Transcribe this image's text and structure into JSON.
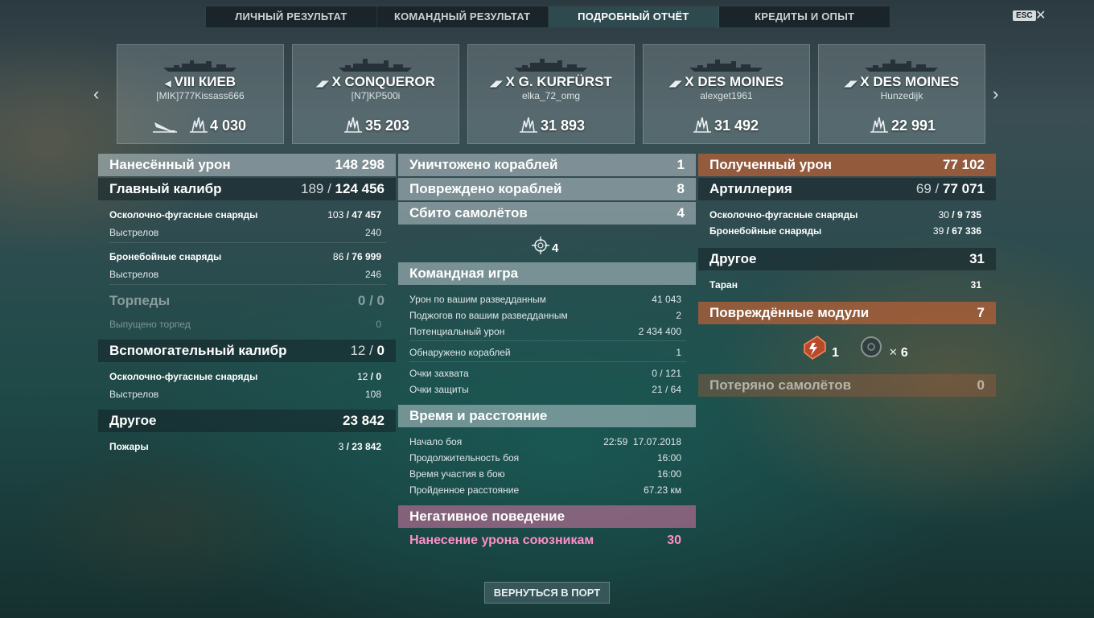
{
  "tabs": [
    "ЛИЧНЫЙ РЕЗУЛЬТАТ",
    "КОМАНДНЫЙ РЕЗУЛЬТАТ",
    "ПОДРОБНЫЙ ОТЧЁТ",
    "КРЕДИТЫ И ОПЫТ"
  ],
  "active_tab": "ПОДРОБНЫЙ ОТЧЁТ",
  "esc_label": "ESC",
  "close_glyph": "✕",
  "ships": [
    {
      "tier": "VIII",
      "name": "КИЕВ",
      "player": "[MIK]777Kissass666",
      "damage": "4 030",
      "sunk": true
    },
    {
      "tier": "X",
      "name": "CONQUEROR",
      "player": "[N7]KP500i",
      "damage": "35 203",
      "sunk": false
    },
    {
      "tier": "X",
      "name": "G. KURFÜRST",
      "player": "elka_72_omg",
      "damage": "31 893",
      "sunk": false
    },
    {
      "tier": "X",
      "name": "DES MOINES",
      "player": "alexget1961",
      "damage": "31 492",
      "sunk": false
    },
    {
      "tier": "X",
      "name": "DES MOINES",
      "player": "Hunzedijk",
      "damage": "22 991",
      "sunk": false
    }
  ],
  "left": {
    "dealt": {
      "label": "Нанесённый урон",
      "value": "148 298"
    },
    "main": {
      "label": "Главный калибр",
      "hits": "189",
      "value": "124 456"
    },
    "he": {
      "label": "Осколочно-фугасные снаряды",
      "hits": "103",
      "value": "47 457"
    },
    "he_shots": {
      "label": "Выстрелов",
      "value": "240"
    },
    "ap": {
      "label": "Бронебойные снаряды",
      "hits": "86",
      "value": "76 999"
    },
    "ap_shots": {
      "label": "Выстрелов",
      "value": "246"
    },
    "torp": {
      "label": "Торпеды",
      "hits": "0",
      "value": "0"
    },
    "torp_fired": {
      "label": "Выпущено торпед",
      "value": "0"
    },
    "secondary": {
      "label": "Вспомогательный калибр",
      "hits": "12",
      "value": "0"
    },
    "sec_he": {
      "label": "Осколочно-фугасные снаряды",
      "hits": "12",
      "value": "0"
    },
    "sec_shots": {
      "label": "Выстрелов",
      "value": "108"
    },
    "other": {
      "label": "Другое",
      "value": "23 842"
    },
    "fires": {
      "label": "Пожары",
      "hits": "3",
      "value": "23 842"
    }
  },
  "mid": {
    "destroyed": {
      "label": "Уничтожено кораблей",
      "value": "1"
    },
    "damaged": {
      "label": "Повреждено кораблей",
      "value": "8"
    },
    "planes": {
      "label": "Сбито самолётов",
      "value": "4"
    },
    "spotting_count": "4",
    "team": {
      "label": "Командная игра"
    },
    "spot_dmg": {
      "label": "Урон по вашим разведданным",
      "value": "41 043"
    },
    "spot_fires": {
      "label": "Поджогов по вашим разведданным",
      "value": "2"
    },
    "potential": {
      "label": "Потенциальный урон",
      "value": "2 434 400"
    },
    "detected": {
      "label": "Обнаружено кораблей",
      "value": "1"
    },
    "cap": {
      "label": "Очки захвата",
      "value": "0 / 121"
    },
    "defense": {
      "label": "Очки защиты",
      "value": "21 / 64"
    },
    "time": {
      "label": "Время и расстояние"
    },
    "start": {
      "label": "Начало боя",
      "value": "22:59  17.07.2018"
    },
    "duration": {
      "label": "Продолжительность боя",
      "value": "16:00"
    },
    "participation": {
      "label": "Время участия в бою",
      "value": "16:00"
    },
    "distance": {
      "label": "Пройденное расстояние",
      "value": "67.23 км"
    },
    "negative": {
      "label": "Негативное поведение"
    },
    "ally_dmg": {
      "label": "Нанесение урона союзникам",
      "value": "30"
    }
  },
  "right": {
    "received": {
      "label": "Полученный урон",
      "value": "77 102"
    },
    "artillery": {
      "label": "Артиллерия",
      "hits": "69",
      "value": "77 071"
    },
    "he": {
      "label": "Осколочно-фугасные снаряды",
      "hits": "30",
      "value": "9 735"
    },
    "ap": {
      "label": "Бронебойные снаряды",
      "hits": "39",
      "value": "67 336"
    },
    "other": {
      "label": "Другое",
      "value": "31"
    },
    "ram": {
      "label": "Таран",
      "value": "31"
    },
    "modules": {
      "label": "Повреждённые модули",
      "value": "7"
    },
    "module_engine_count": "1",
    "module_rudder_count": "6",
    "module_multiplier": "✕",
    "planes_lost": {
      "label": "Потеряно самолётов",
      "value": "0"
    }
  },
  "return_button": "ВЕРНУТЬСЯ В ПОРТ"
}
